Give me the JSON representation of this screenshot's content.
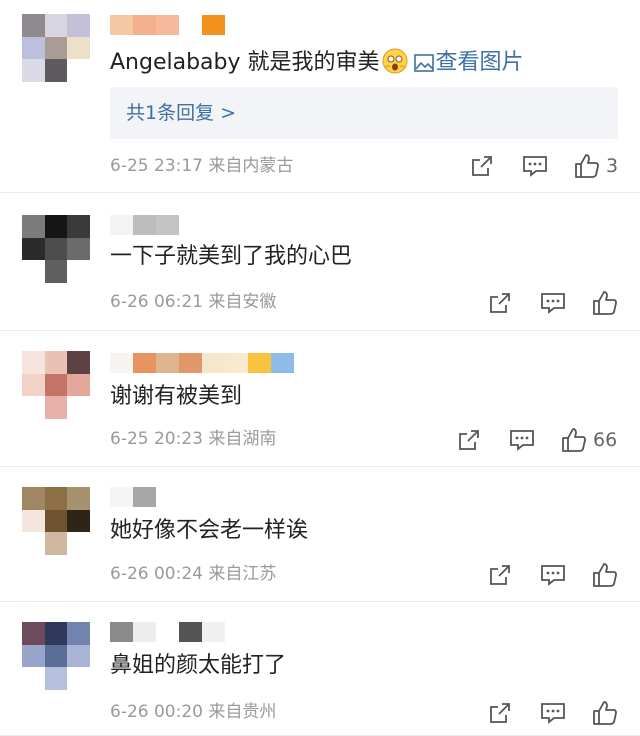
{
  "comments": [
    {
      "text": "Angelababy 就是我的审美",
      "view_image": "查看图片",
      "reply_summary": "共1条回复 >",
      "time": "6-25 23:17",
      "location": "来自内蒙古",
      "like_count": "3"
    },
    {
      "text": "一下子就美到了我的心巴",
      "time": "6-26 06:21",
      "location": "来自安徽",
      "like_count": ""
    },
    {
      "text": "谢谢有被美到",
      "time": "6-25 20:23",
      "location": "来自湖南",
      "like_count": "66"
    },
    {
      "text": "她好像不会老一样诶",
      "time": "6-26 00:24",
      "location": "来自江苏",
      "like_count": ""
    },
    {
      "text": "鼻姐的颜太能打了",
      "time": "6-26 00:20",
      "location": "来自贵州",
      "like_count": ""
    }
  ],
  "icons": [
    "share-icon",
    "comment-icon",
    "like-icon",
    "picture-icon",
    "emoji-icon"
  ],
  "colors": {
    "link": "#3f70a4",
    "meta": "#9a9a9a",
    "reply_bg": "#f2f4f7"
  }
}
